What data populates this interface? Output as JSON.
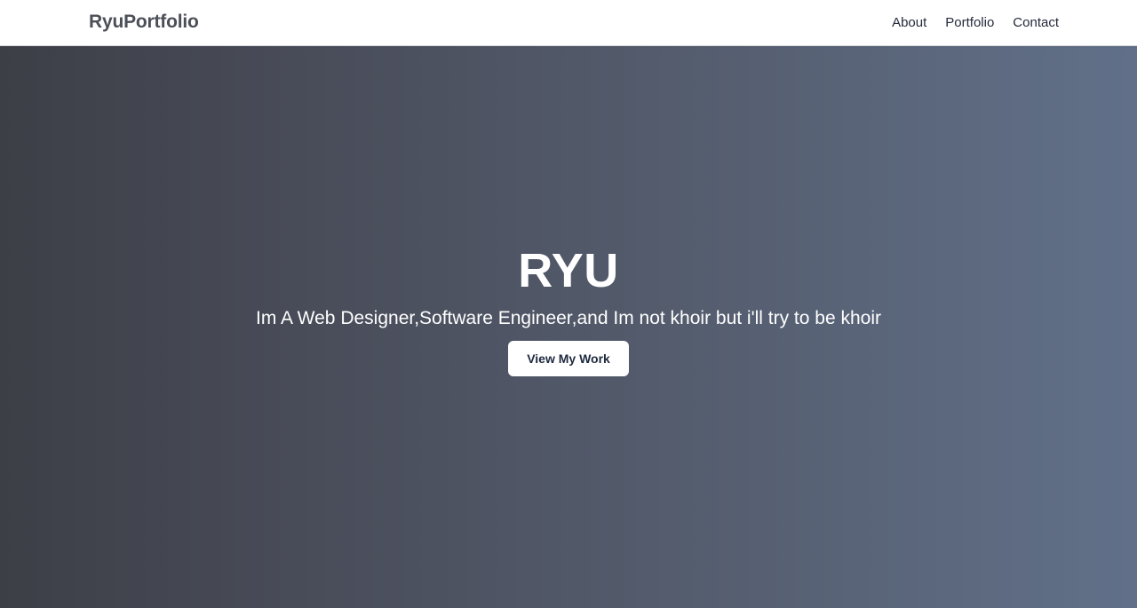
{
  "navbar": {
    "brand": "RyuPortfolio",
    "links": [
      {
        "label": "About"
      },
      {
        "label": "Portfolio"
      },
      {
        "label": "Contact"
      }
    ]
  },
  "hero": {
    "title": "RYU",
    "subtitle": "Im A Web Designer,Software Engineer,and Im not khoir but i'll try to be khoir",
    "cta_label": "View My Work"
  },
  "colors": {
    "gradient_start": "#3d3f47",
    "gradient_end": "#617089",
    "brand_text": "#4b4f58",
    "nav_text": "#232a3b",
    "button_text": "#1f2a3f"
  }
}
